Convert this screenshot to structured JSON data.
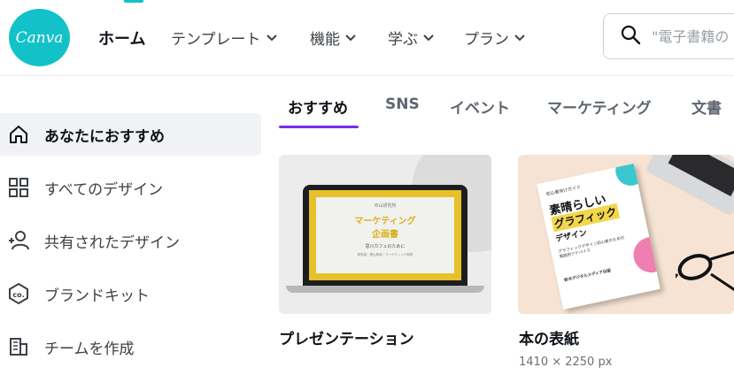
{
  "header": {
    "logo_text": "Canva",
    "nav": [
      {
        "label": "ホーム"
      },
      {
        "label": "テンプレート"
      },
      {
        "label": "機能"
      },
      {
        "label": "学ぶ"
      },
      {
        "label": "プラン"
      }
    ],
    "search_placeholder": "\"電子書籍の"
  },
  "sidebar": {
    "items": [
      {
        "label": "あなたにおすすめ",
        "icon": "home-icon",
        "active": true
      },
      {
        "label": "すべてのデザイン",
        "icon": "grid-icon"
      },
      {
        "label": "共有されたデザイン",
        "icon": "shared-users-icon"
      },
      {
        "label": "ブランドキット",
        "icon": "brand-kit-icon"
      },
      {
        "label": "チームを作成",
        "icon": "team-building-icon"
      }
    ]
  },
  "tabs": [
    {
      "label": "おすすめ",
      "active": true
    },
    {
      "label": "SNS"
    },
    {
      "label": "イベント"
    },
    {
      "label": "マーケティング"
    },
    {
      "label": "文書"
    }
  ],
  "cards": [
    {
      "title": "プレゼンテーション",
      "slide": {
        "header": "中山研究所",
        "title_line1": "マーケティング",
        "title_line2": "企画書",
        "subtitle": "思川カフェのために",
        "footer": "発表者：黒山美和・マーケティング部長"
      }
    },
    {
      "title": "本の表紙",
      "size": "1410 × 2250 px",
      "book": {
        "top": "初心者向けガイド",
        "title_line1": "素晴らしい",
        "title_line2": "グラフィック",
        "title_line3": "デザイン",
        "desc": "グラフィックデザイン初心者のための実践的アドバイス",
        "publisher": "鈴木デジタルメディア出版"
      }
    }
  ],
  "colors": {
    "brand": "#13c2c9",
    "tab_accent": "#7d2ae8",
    "slide_accent": "#e6c12a"
  }
}
